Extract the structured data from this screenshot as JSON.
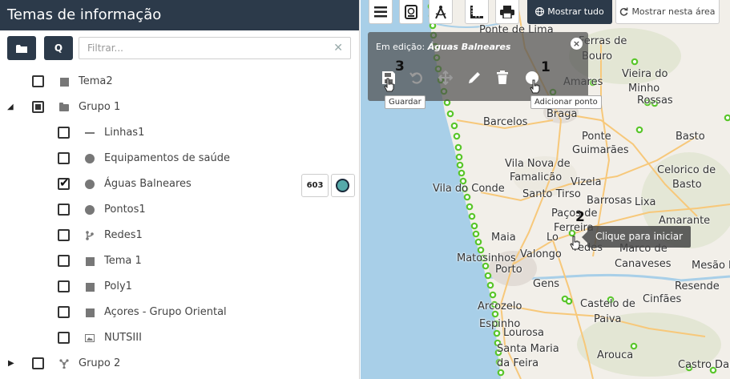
{
  "sidebar": {
    "title": "Temas de informação",
    "filter_placeholder": "Filtrar...",
    "filter_clear": "✕",
    "folder_button_icon": "folder-icon",
    "query_button_label": "Q",
    "tree": [
      {
        "label": "Tema2",
        "icon": "square-icon",
        "checkbox": "unchecked",
        "level": 0
      },
      {
        "label": "Grupo 1",
        "icon": "folder-icon",
        "checkbox": "partial",
        "level": 0,
        "expanded": true
      },
      {
        "label": "Linhas1",
        "icon": "line-icon",
        "checkbox": "unchecked",
        "level": 1
      },
      {
        "label": "Equipamentos de saúde",
        "icon": "circle-icon",
        "checkbox": "unchecked",
        "level": 1
      },
      {
        "label": "Águas Balneares",
        "icon": "circle-icon",
        "checkbox": "checked",
        "level": 1,
        "count": "603"
      },
      {
        "label": "Pontos1",
        "icon": "circle-icon",
        "checkbox": "unchecked",
        "level": 1
      },
      {
        "label": "Redes1",
        "icon": "network-icon",
        "checkbox": "unchecked",
        "level": 1
      },
      {
        "label": "Tema 1",
        "icon": "square-icon",
        "checkbox": "unchecked",
        "level": 1
      },
      {
        "label": "Poly1",
        "icon": "square-icon",
        "checkbox": "unchecked",
        "level": 1
      },
      {
        "label": "Açores - Grupo Oriental",
        "icon": "square-icon",
        "checkbox": "unchecked",
        "level": 1
      },
      {
        "label": "NUTSIII",
        "icon": "image-icon",
        "checkbox": "unchecked",
        "level": 1
      },
      {
        "label": "Grupo 2",
        "icon": "network-icon",
        "checkbox": "unchecked",
        "level": 0,
        "expanded": false
      }
    ]
  },
  "map": {
    "toolbar": {
      "show_all": "Mostrar tudo",
      "show_in_area": "Mostrar nesta área"
    },
    "edit_panel": {
      "prefix": "Em edição:",
      "layer": "Águas Balneares",
      "close": "×"
    },
    "tooltips": {
      "save": "Guardar",
      "add_point": "Adicionar ponto",
      "click_to_start": "Clique para iniciar"
    },
    "steps": [
      "1",
      "2",
      "3"
    ],
    "places": [
      "Ponte de Lima",
      "Ferras de",
      "Bouro",
      "Amares",
      "Vieira do",
      "Minho",
      "Rossas",
      "Braga",
      "Barcelos",
      "Basto",
      "Ponte",
      "Guimarães",
      "Vila Nova de",
      "Famalicão",
      "Celorico de",
      "Basto",
      "Vizela",
      "Vila do Conde",
      "Santo Tirso",
      "Barrosas",
      "Lixa",
      "Paços de",
      "Ferreira",
      "Amarante",
      "Maia",
      "Lo",
      "redes",
      "Marco de",
      "Canaveses",
      "Matosinhos",
      "Valongo",
      "Porto",
      "Mesão F",
      "Gens",
      "Resende",
      "Arcozelo",
      "Castelo de",
      "Paiva",
      "Cinfães",
      "Espinho",
      "Lourosa",
      "Santa Maria",
      "da Feira",
      "Arouca",
      "Castro Dai"
    ],
    "colors": {
      "sea": "#a8cfe8",
      "land": "#f1eee8",
      "road": "#f7c87a",
      "point": "#59c62a",
      "dark": "#2c3a4a"
    }
  }
}
